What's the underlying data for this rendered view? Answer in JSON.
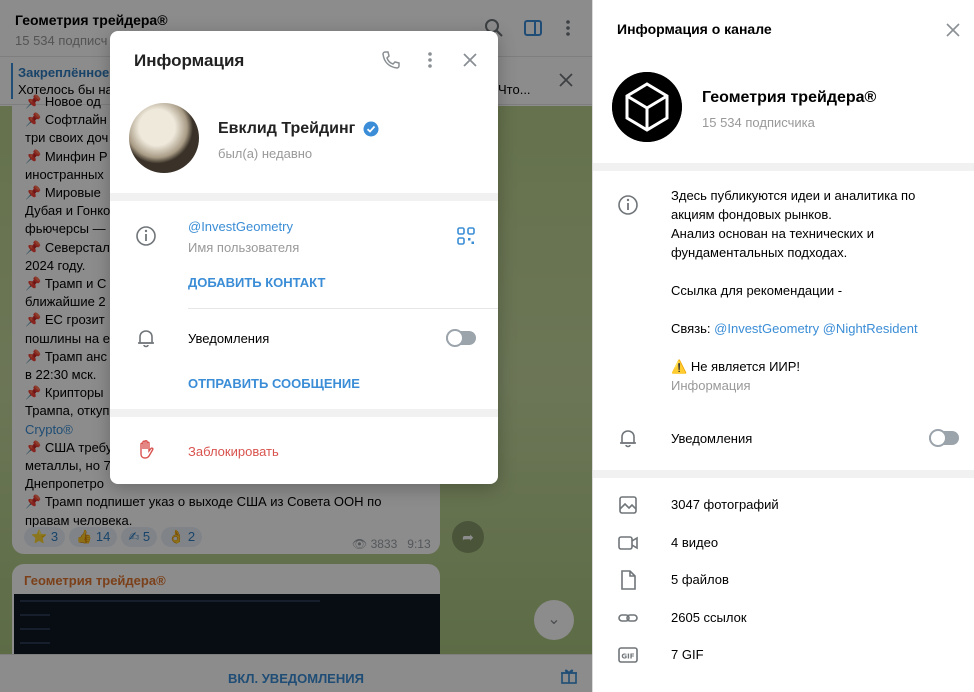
{
  "chat": {
    "title": "Геометрия трейдера®",
    "subscribers": "15 534 подписч",
    "pinned_title": "Закреплённое",
    "pinned_text": "Хотелось бы на",
    "pinned_text_right": "Что...",
    "message_lines": [
      {
        "pin": true,
        "text": "Новое од"
      },
      {
        "pin": true,
        "text": "Софтлайн"
      },
      {
        "pin": false,
        "text": "три своих доч"
      },
      {
        "pin": true,
        "text": "Минфин Р"
      },
      {
        "pin": false,
        "text": "иностранных"
      },
      {
        "pin": true,
        "text": "Мировые"
      },
      {
        "pin": false,
        "text": "Дубая и Гонко"
      },
      {
        "pin": false,
        "text": "фьючерсы —"
      },
      {
        "pin": true,
        "text": "Северстал"
      },
      {
        "pin": false,
        "text": "2024 году."
      },
      {
        "pin": true,
        "text": "Трамп и С"
      },
      {
        "pin": false,
        "text": "ближайшие 2"
      },
      {
        "pin": true,
        "text": "ЕС грозит"
      },
      {
        "pin": false,
        "text": "пошлины на е"
      },
      {
        "pin": true,
        "text": "Трамп анс"
      },
      {
        "pin": false,
        "text": "в 22:30 мск."
      },
      {
        "pin": true,
        "text": "Крипторы"
      },
      {
        "pin": false,
        "text": "Трампа, откуп"
      },
      {
        "pin": false,
        "text": "Crypto®",
        "link": true
      },
      {
        "pin": true,
        "text": "США требу"
      },
      {
        "pin": false,
        "text": "металлы, но 7"
      },
      {
        "pin": false,
        "text": "Днепропетро"
      },
      {
        "pin": true,
        "text": "Трамп подпишет указ о выходе США из Совета ООН по"
      },
      {
        "pin": false,
        "text": "правам человека."
      }
    ],
    "reactions": [
      {
        "emoji": "⭐",
        "count": "3"
      },
      {
        "emoji": "👍",
        "count": "14"
      },
      {
        "emoji": "✍",
        "count": "5"
      },
      {
        "emoji": "👌",
        "count": "2"
      }
    ],
    "views": "3833",
    "time": "9:13",
    "message2_author": "Геометрия трейдера®",
    "bottom_button": "ВКЛ. УВЕДОМЛЕНИЯ"
  },
  "info_panel": {
    "title": "Информация о канале",
    "channel_name": "Геометрия трейдера®",
    "subscribers": "15 534 подписчика",
    "description_lines": [
      "Здесь публикуются идеи и аналитика по",
      "акциям фондовых рынков.",
      "Анализ основан на технических и",
      "фундаментальных подходах.",
      "",
      "Ссылка для рекомендации -",
      ""
    ],
    "contact_prefix": "Связь: ",
    "contact_link1": "@InvestGeometry",
    "contact_link2": "@NightResident",
    "warning": "Не является ИИР!",
    "info_label": "Информация",
    "notifications_label": "Уведомления",
    "notifications_on": false,
    "media": [
      {
        "icon": "photo-icon",
        "label": "3047 фотографий"
      },
      {
        "icon": "video-icon",
        "label": "4 видео"
      },
      {
        "icon": "file-icon",
        "label": "5 файлов"
      },
      {
        "icon": "link-icon",
        "label": "2605 ссылок"
      },
      {
        "icon": "gif-icon",
        "label": "7 GIF"
      }
    ]
  },
  "modal": {
    "title": "Информация",
    "user_name": "Евклид Трейдинг",
    "status": "был(а) недавно",
    "username": "@InvestGeometry",
    "username_label": "Имя пользователя",
    "add_contact": "ДОБАВИТЬ КОНТАКТ",
    "notifications_label": "Уведомления",
    "notifications_on": false,
    "send_message": "ОТПРАВИТЬ СООБЩЕНИЕ",
    "block": "Заблокировать"
  },
  "colors": {
    "accent": "#3a8dd6",
    "danger": "#d9534f",
    "chat_background": "#c3d59a"
  }
}
